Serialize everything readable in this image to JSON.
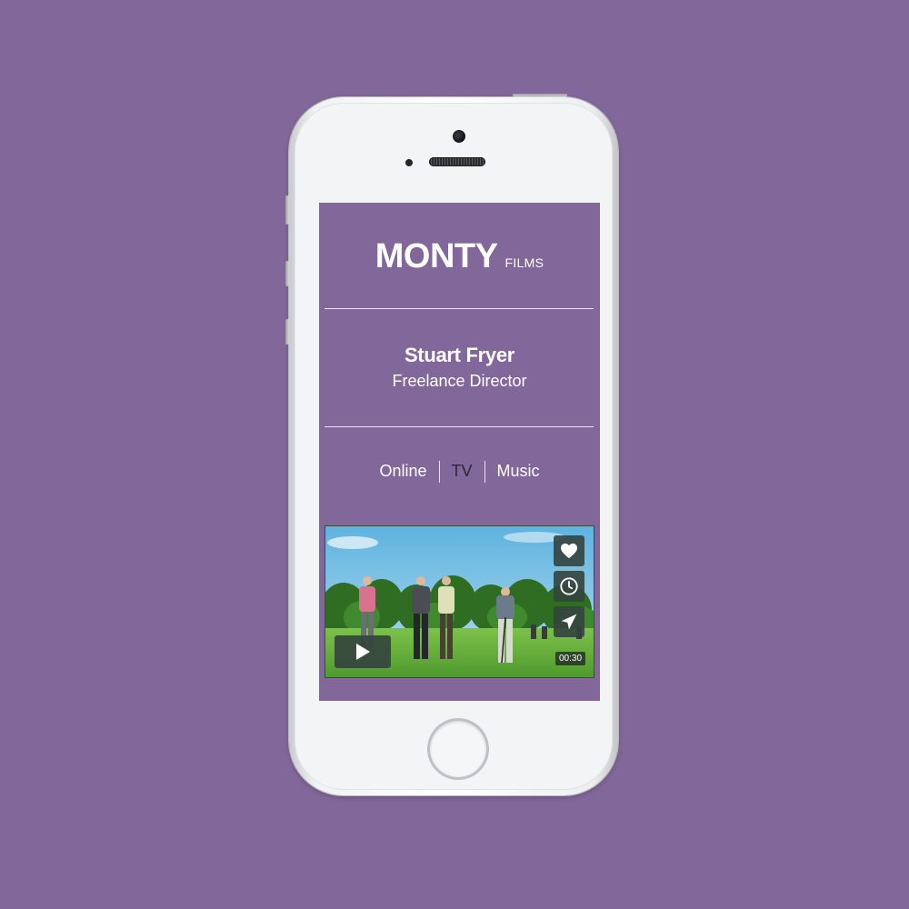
{
  "app": {
    "brand_main": "MONTY",
    "brand_sub": "FILMS"
  },
  "profile": {
    "name": "Stuart Fryer",
    "role": "Freelance Director"
  },
  "nav": {
    "items": [
      {
        "label": "Online",
        "active": false
      },
      {
        "label": "TV",
        "active": true
      },
      {
        "label": "Music",
        "active": false
      }
    ]
  },
  "video": {
    "duration": "00:30",
    "actions": [
      {
        "name": "like",
        "icon": "heart-icon"
      },
      {
        "name": "watch-later",
        "icon": "clock-icon"
      },
      {
        "name": "share",
        "icon": "send-icon"
      }
    ],
    "play_icon": "play-icon"
  },
  "colors": {
    "background": "#82689a",
    "screen": "#82689a",
    "text": "#ffffff",
    "active_nav": "#2e2733",
    "overlay_button": "#34423e"
  }
}
